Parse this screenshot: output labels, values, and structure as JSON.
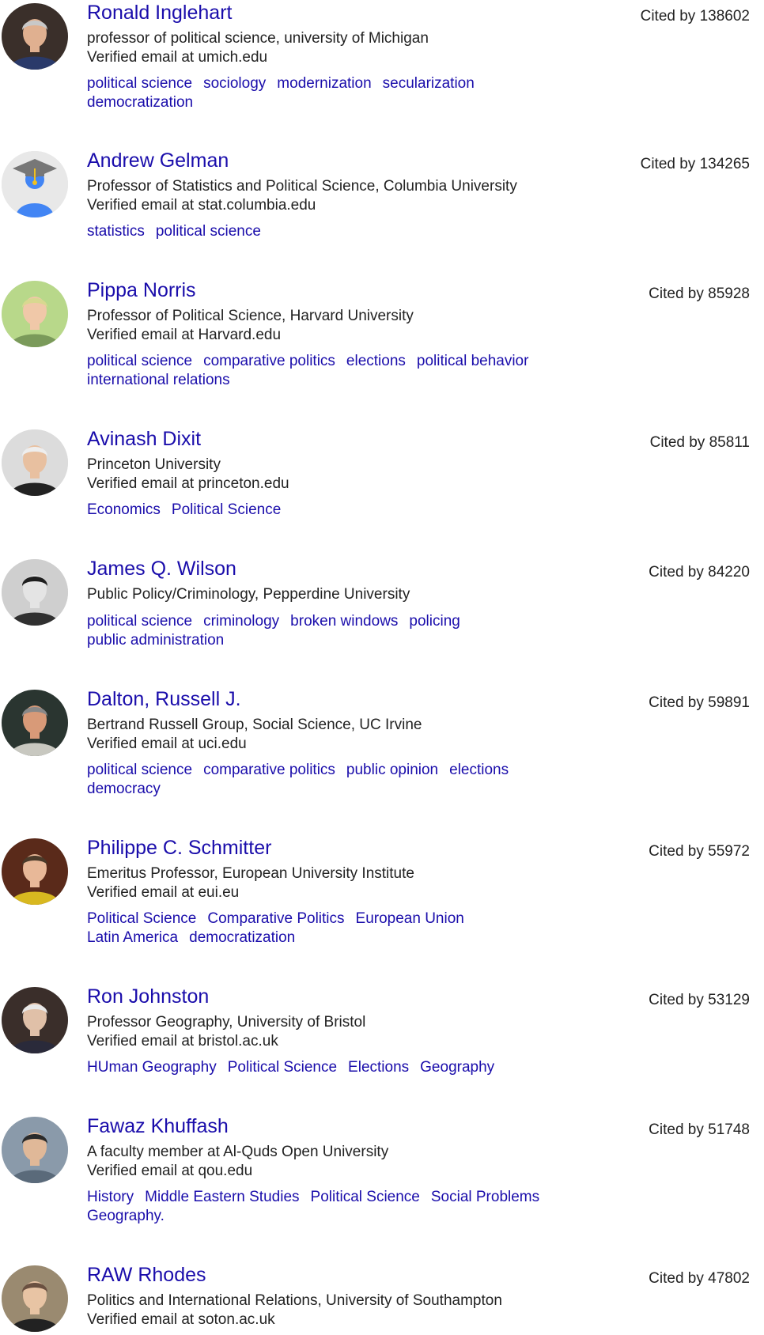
{
  "profiles": [
    {
      "name": "Ronald Inglehart",
      "affiliation": "professor of political science, university of Michigan",
      "email": "Verified email at umich.edu",
      "cited": "Cited by 138602",
      "interests": [
        "political science",
        "sociology",
        "modernization",
        "secularization",
        "democratization"
      ],
      "avatar_icon": "person-photo-icon",
      "colors": {
        "bg": "#3a2f2a",
        "skin": "#e0b090",
        "cloth": "#2a3a6a",
        "hair": "#c8c8c8"
      }
    },
    {
      "name": "Andrew Gelman",
      "affiliation": "Professor of Statistics and Political Science, Columbia University",
      "email": "Verified email at stat.columbia.edu",
      "cited": "Cited by 134265",
      "interests": [
        "statistics",
        "political science"
      ],
      "avatar_icon": "default-graduate-avatar-icon",
      "colors": {
        "bg": "#e8e8e8",
        "skin": "#4285f4",
        "cloth": "#4285f4",
        "hair": "#777777"
      }
    },
    {
      "name": "Pippa Norris",
      "affiliation": "Professor of Political Science, Harvard University",
      "email": "Verified email at Harvard.edu",
      "cited": "Cited by 85928",
      "interests": [
        "political science",
        "comparative politics",
        "elections",
        "political behavior",
        "international relations"
      ],
      "avatar_icon": "person-photo-icon",
      "colors": {
        "bg": "#b8d88a",
        "skin": "#f0c8a8",
        "cloth": "#7a9a5a",
        "hair": "#d8d890"
      }
    },
    {
      "name": "Avinash Dixit",
      "affiliation": "Princeton University",
      "email": "Verified email at princeton.edu",
      "cited": "Cited by 85811",
      "interests": [
        "Economics",
        "Political Science"
      ],
      "avatar_icon": "person-photo-icon",
      "colors": {
        "bg": "#dcdcdc",
        "skin": "#e8c0a0",
        "cloth": "#222222",
        "hair": "#eeeeee"
      }
    },
    {
      "name": "James Q. Wilson",
      "affiliation": "Public Policy/Criminology, Pepperdine University",
      "email": "",
      "cited": "Cited by 84220",
      "interests": [
        "political science",
        "criminology",
        "broken windows",
        "policing",
        "public administration"
      ],
      "avatar_icon": "person-photo-icon",
      "colors": {
        "bg": "#cfcfcf",
        "skin": "#e4e4e4",
        "cloth": "#303030",
        "hair": "#1e1e1e"
      }
    },
    {
      "name": "Dalton, Russell J.",
      "affiliation": "Bertrand Russell Group, Social Science, UC Irvine",
      "email": "Verified email at uci.edu",
      "cited": "Cited by 59891",
      "interests": [
        "political science",
        "comparative politics",
        "public opinion",
        "elections",
        "democracy"
      ],
      "avatar_icon": "person-photo-icon",
      "colors": {
        "bg": "#2a3530",
        "skin": "#d89a78",
        "cloth": "#c8c8c0",
        "hair": "#888888"
      }
    },
    {
      "name": "Philippe C. Schmitter",
      "affiliation": "Emeritus Professor, European University Institute",
      "email": "Verified email at eui.eu",
      "cited": "Cited by 55972",
      "interests": [
        "Political Science",
        "Comparative Politics",
        "European Union",
        "Latin America",
        "democratization"
      ],
      "avatar_icon": "person-photo-icon",
      "colors": {
        "bg": "#5a2a1a",
        "skin": "#e8b898",
        "cloth": "#d8b820",
        "hair": "#4a3a2a"
      }
    },
    {
      "name": "Ron Johnston",
      "affiliation": "Professor Geography, University of Bristol",
      "email": "Verified email at bristol.ac.uk",
      "cited": "Cited by 53129",
      "interests": [
        "HUman Geography",
        "Political Science",
        "Elections",
        "Geography"
      ],
      "avatar_icon": "person-photo-icon",
      "colors": {
        "bg": "#3a2e2a",
        "skin": "#e0c0a8",
        "cloth": "#2a2a3a",
        "hair": "#e8e8e8"
      }
    },
    {
      "name": "Fawaz Khuffash",
      "affiliation": "A faculty member at Al-Quds Open University",
      "email": "Verified email at qou.edu",
      "cited": "Cited by 51748",
      "interests": [
        "History",
        "Middle Eastern Studies",
        "Political Science",
        "Social Problems",
        "Geography."
      ],
      "avatar_icon": "person-photo-icon",
      "colors": {
        "bg": "#8a9aaa",
        "skin": "#e0b898",
        "cloth": "#5a6a7a",
        "hair": "#2a2a2a"
      }
    },
    {
      "name": "RAW Rhodes",
      "affiliation": "Politics and International Relations, University of Southampton",
      "email": "Verified email at soton.ac.uk",
      "cited": "Cited by 47802",
      "interests": [],
      "avatar_icon": "person-photo-icon",
      "colors": {
        "bg": "#9a8a70",
        "skin": "#e8c4a4",
        "cloth": "#222222",
        "hair": "#6a5040"
      }
    }
  ]
}
